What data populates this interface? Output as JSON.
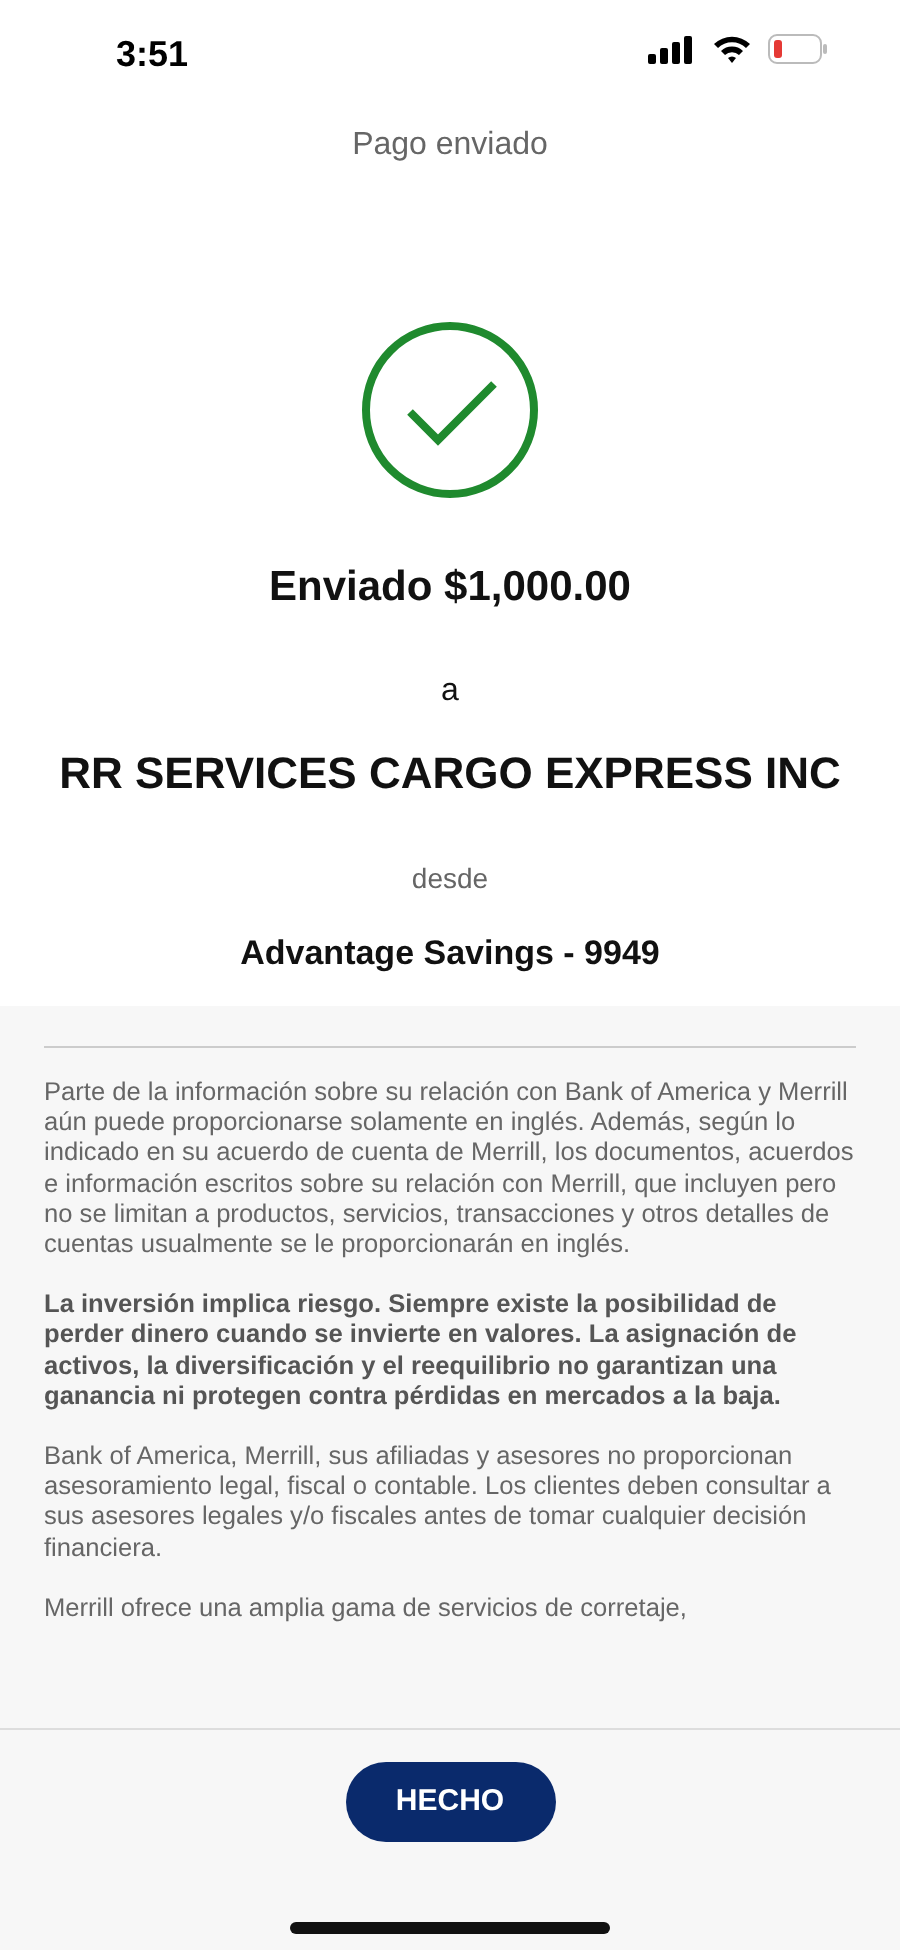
{
  "status_bar": {
    "time": "3:51"
  },
  "header": {
    "title": "Pago enviado"
  },
  "confirmation": {
    "amount_line": "Enviado $1,000.00",
    "to_label": "a",
    "recipient": "RR SERVICES CARGO EXPRESS INC",
    "from_label": "desde",
    "account": "Advantage Savings - 9949"
  },
  "disclosures": [
    {
      "text": "Parte de la información sobre su relación con Bank of America y Merrill aún puede proporcionarse solamente en inglés. Además, según lo indicado en su acuerdo de cuenta de Merrill, los documentos, acuerdos e información escritos sobre su relación con Merrill, que incluyen pero no se limitan a productos, servicios, transacciones y otros detalles de cuentas usualmente se le proporcionarán en inglés.",
      "bold": false
    },
    {
      "text": "La inversión implica riesgo. Siempre existe la posibilidad de perder dinero cuando se invierte en valores. La asignación de activos, la diversificación y el reequilibrio no garantizan una ganancia ni protegen contra pérdidas en mercados a la baja.",
      "bold": true
    },
    {
      "text": "Bank of America, Merrill, sus afiliadas y asesores no proporcionan asesoramiento legal, fiscal o contable. Los clientes deben consultar a sus asesores legales y/o fiscales antes de tomar cualquier decisión financiera.",
      "bold": false
    },
    {
      "text": "Merrill ofrece una amplia gama de servicios de corretaje,",
      "bold": false
    }
  ],
  "done_button": {
    "label": "HECHO"
  }
}
